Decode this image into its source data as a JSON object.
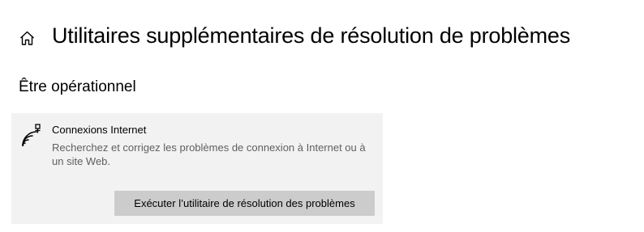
{
  "header": {
    "home_icon": "home-icon",
    "title": "Utilitaires supplémentaires de résolution de problèmes"
  },
  "section": {
    "heading": "Être opérationnel"
  },
  "troubleshooters": [
    {
      "icon": "internet-connection-icon",
      "title": "Connexions Internet",
      "description": "Recherchez et corrigez les problèmes de connexion à Internet ou à un site Web.",
      "button_label": "Exécuter l’utilitaire de résolution des problèmes"
    }
  ],
  "colors": {
    "card_background": "#f2f2f2",
    "button_background": "#cccccc",
    "description_text": "#5f5f5f"
  }
}
